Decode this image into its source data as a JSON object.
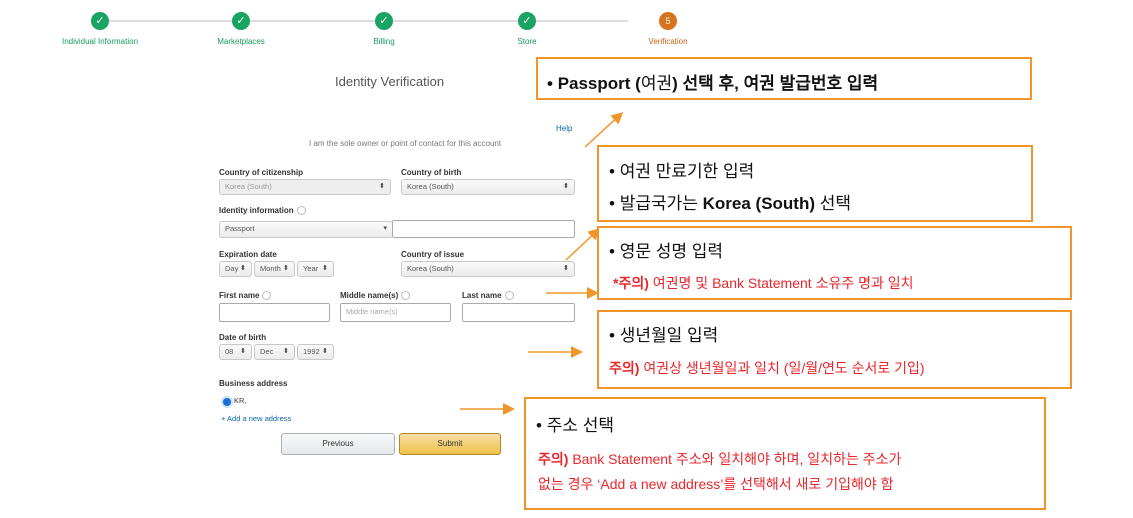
{
  "stepper": {
    "steps": [
      {
        "label": "Individual Information",
        "state": "done"
      },
      {
        "label": "Marketplaces",
        "state": "done"
      },
      {
        "label": "Billing",
        "state": "done"
      },
      {
        "label": "Store",
        "state": "done"
      },
      {
        "label": "Verification",
        "state": "current",
        "number": "5"
      }
    ],
    "done_color": "#19a463",
    "current_color": "#d6731c"
  },
  "form": {
    "title": "Identity Verification",
    "help_link": "Help",
    "sole_owner_text": "I am the sole owner or point of contact for this account",
    "citizenship_label": "Country of citizenship",
    "citizenship_value": "Korea (South)",
    "birth_country_label": "Country of birth",
    "birth_country_value": "Korea (South)",
    "identity_label": "Identity information",
    "identity_value": "Passport",
    "identity_number_value": "",
    "expiration_label": "Expiration date",
    "exp_day": "Day",
    "exp_month": "Month",
    "exp_year": "Year",
    "issue_country_label": "Country of issue",
    "issue_country_value": "Korea (South)",
    "first_name_label": "First name",
    "middle_name_label": "Middle name(s)",
    "middle_name_placeholder": "Middle name(s)",
    "last_name_label": "Last name",
    "dob_label": "Date of birth",
    "dob_day": "08",
    "dob_month": "Dec",
    "dob_year": "1992",
    "business_address_label": "Business address",
    "address_option": "KR,",
    "add_address_link": "+ Add a new address",
    "previous_button": "Previous",
    "submit_button": "Submit"
  },
  "notes": {
    "n1": {
      "p1": "Passport (",
      "p2": "여권",
      "p3": ") 선택 후, 여권 발급번호 입력"
    },
    "n2": {
      "l1": "여권 만료기한 입력",
      "l2a": "발급국가는 ",
      "l2b": "Korea (South)",
      "l2c": " 선택"
    },
    "n3": {
      "l1": "영문 성명 입력",
      "l2a": "*주의)",
      "l2b": " 여권명 및 Bank Statement 소유주 명과 일치"
    },
    "n4": {
      "l1": "생년월일 입력",
      "l2a": "주의)",
      "l2b": " 여권상 생년월일과 일치 (일/월/연도 순서로 기입)"
    },
    "n5": {
      "l1": "주소 선택",
      "l2a": "주의)",
      "l2b": " Bank Statement 주소와 일치해야 하며, 일치하는 주소가",
      "l3": "없는 경우 ‘Add a new address’를 선택해서 새로 기입해야 함"
    }
  },
  "accent_color": "#f0952b",
  "warning_color": "#e8262b"
}
